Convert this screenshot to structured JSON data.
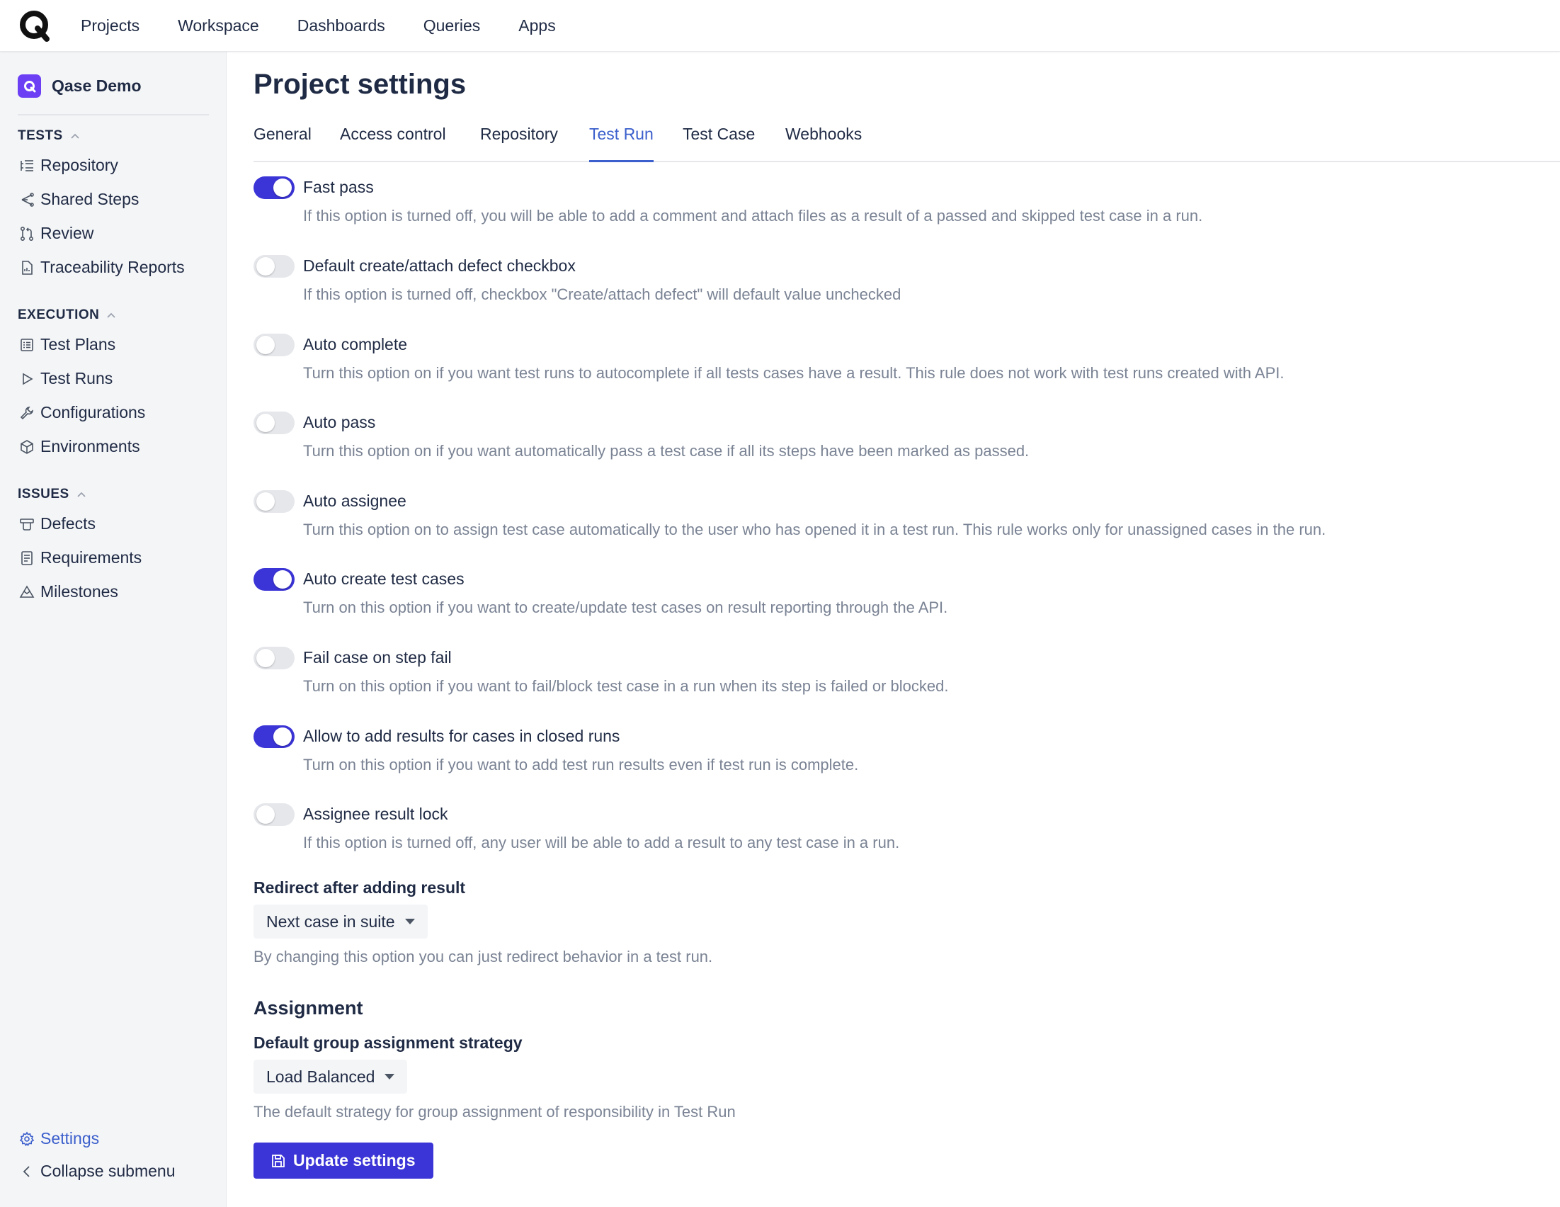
{
  "topnav": {
    "logo_icon": "qase-logo-icon",
    "items": [
      "Projects",
      "Workspace",
      "Dashboards",
      "Queries",
      "Apps"
    ]
  },
  "sidebar": {
    "project_name": "Qase Demo",
    "sections": [
      {
        "title": "TESTS",
        "items": [
          "Repository",
          "Shared Steps",
          "Review",
          "Traceability Reports"
        ]
      },
      {
        "title": "EXECUTION",
        "items": [
          "Test Plans",
          "Test Runs",
          "Configurations",
          "Environments"
        ]
      },
      {
        "title": "ISSUES",
        "items": [
          "Defects",
          "Requirements",
          "Milestones"
        ]
      }
    ],
    "settings_label": "Settings",
    "collapse_label": "Collapse submenu"
  },
  "main": {
    "title": "Project settings",
    "tabs": [
      "General",
      "Access control",
      "Repository",
      "Test Run",
      "Test Case",
      "Webhooks"
    ],
    "active_tab": "Test Run",
    "options": [
      {
        "label": "Fast pass",
        "enabled": true,
        "description": "If this option is turned off, you will be able to add a comment and attach files as a result of a passed and skipped test case in a run."
      },
      {
        "label": "Default create/attach defect checkbox",
        "enabled": false,
        "description": "If this option is turned off, checkbox \"Create/attach defect\" will default value unchecked"
      },
      {
        "label": "Auto complete",
        "enabled": false,
        "description": "Turn this option on if you want test runs to autocomplete if all tests cases have a result. This rule does not work with test runs created with API."
      },
      {
        "label": "Auto pass",
        "enabled": false,
        "description": "Turn this option on if you want automatically pass a test case if all its steps have been marked as passed."
      },
      {
        "label": "Auto assignee",
        "enabled": false,
        "description": "Turn this option on to assign test case automatically to the user who has opened it in a test run. This rule works only for unassigned cases in the run."
      },
      {
        "label": "Auto create test cases",
        "enabled": true,
        "description": "Turn on this option if you want to create/update test cases on result reporting through the API."
      },
      {
        "label": "Fail case on step fail",
        "enabled": false,
        "description": "Turn on this option if you want to fail/block test case in a run when its step is failed or blocked."
      },
      {
        "label": "Allow to add results for cases in closed runs",
        "enabled": true,
        "description": "Turn on this option if you want to add test run results even if test run is complete."
      },
      {
        "label": "Assignee result lock",
        "enabled": false,
        "description": "If this option is turned off, any user will be able to add a result to any test case in a run."
      }
    ],
    "redirect": {
      "label": "Redirect after adding result",
      "value": "Next case in suite",
      "help": "By changing this option you can just redirect behavior in a test run."
    },
    "assignment": {
      "title": "Assignment",
      "label": "Default group assignment strategy",
      "value": "Load Balanced",
      "help": "The default strategy for group assignment of responsibility in Test Run"
    },
    "update_button": "Update settings"
  },
  "colors": {
    "accent": "#3b34d6",
    "link": "#3b5fcc",
    "brand": "#6c3ff5"
  }
}
